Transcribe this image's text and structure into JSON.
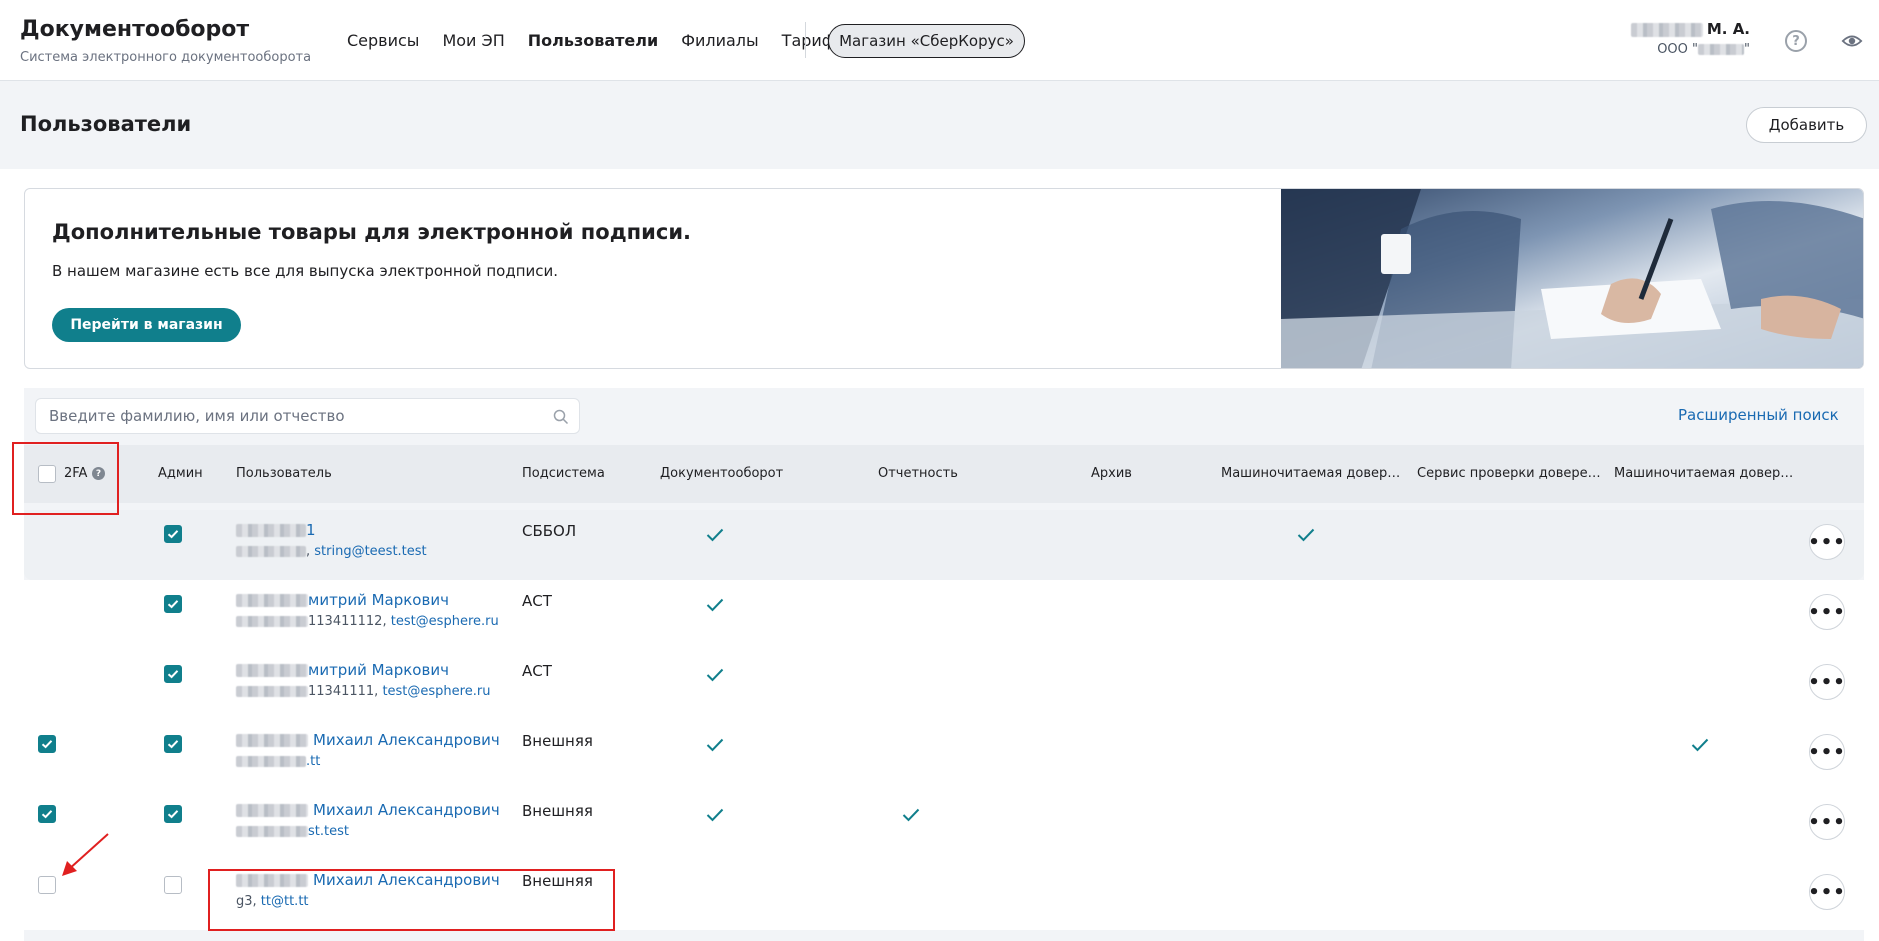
{
  "header": {
    "title": "Документооборот",
    "subtitle": "Система электронного документооборота",
    "nav": [
      {
        "label": "Сервисы",
        "active": false
      },
      {
        "label": "Мои ЭП",
        "active": false
      },
      {
        "label": "Пользователи",
        "active": true
      },
      {
        "label": "Филиалы",
        "active": false
      },
      {
        "label": "Тарифы",
        "active": false
      }
    ],
    "shop_button": "Магазин «СберКорус»",
    "user_initials": "М. А.",
    "user_org_prefix": "ООО \"",
    "user_org_suffix": "\"",
    "icons": [
      "help-icon",
      "eye-icon"
    ]
  },
  "page": {
    "title": "Пользователи",
    "add_button": "Добавить"
  },
  "banner": {
    "title": "Дополнительные товары для электронной подписи.",
    "text": "В нашем магазине есть все для выпуска электронной подписи.",
    "button": "Перейти в магазин"
  },
  "search": {
    "placeholder": "Введите фамилию, имя или отчество",
    "advanced": "Расширенный поиск"
  },
  "table": {
    "columns": {
      "twofa": "2FA",
      "admin": "Админ",
      "user": "Пользователь",
      "subsystem": "Подсистема",
      "docflow": "Документооборот",
      "reporting": "Отчетность",
      "archive": "Архив",
      "machine1": "Машиночитаемая довер…",
      "verify": "Сервис проверки довере…",
      "machine2": "Машиночитаемая довер…"
    },
    "rows": [
      {
        "twofa": false,
        "admin": true,
        "name": "1",
        "meta_prefix": ", ",
        "email": "string@teest.test",
        "subsystem": "СББОЛ",
        "docflow": true,
        "reporting": false,
        "machine1": true,
        "machine2": false
      },
      {
        "twofa": false,
        "admin": true,
        "name": "митрий Маркович",
        "meta_prefix": "113411112, ",
        "email": "test@esphere.ru",
        "subsystem": "АСТ",
        "docflow": true,
        "reporting": false,
        "machine1": false,
        "machine2": false
      },
      {
        "twofa": false,
        "admin": true,
        "name": "митрий Маркович",
        "meta_prefix": "11341111, ",
        "email": "test@esphere.ru",
        "subsystem": "АСТ",
        "docflow": true,
        "reporting": false,
        "machine1": false,
        "machine2": false
      },
      {
        "twofa": true,
        "admin": true,
        "name": "Михаил Александрович",
        "meta_prefix": "",
        "email": ".tt",
        "subsystem": "Внешняя",
        "docflow": true,
        "reporting": false,
        "machine1": false,
        "machine2": true
      },
      {
        "twofa": true,
        "admin": true,
        "name": "Михаил Александрович",
        "meta_prefix": "",
        "email": "st.test",
        "subsystem": "Внешняя",
        "docflow": true,
        "reporting": true,
        "machine1": false,
        "machine2": false
      },
      {
        "twofa": false,
        "admin": false,
        "name": "Михаил Александрович",
        "meta_prefix": "g3, ",
        "email": "tt@tt.tt",
        "subsystem": "Внешняя",
        "docflow": false,
        "reporting": false,
        "machine1": false,
        "machine2": false
      }
    ],
    "more_label": "•••"
  },
  "colors": {
    "accent": "#107f8c",
    "link": "#1a6ab2",
    "annotation": "#e02020"
  }
}
